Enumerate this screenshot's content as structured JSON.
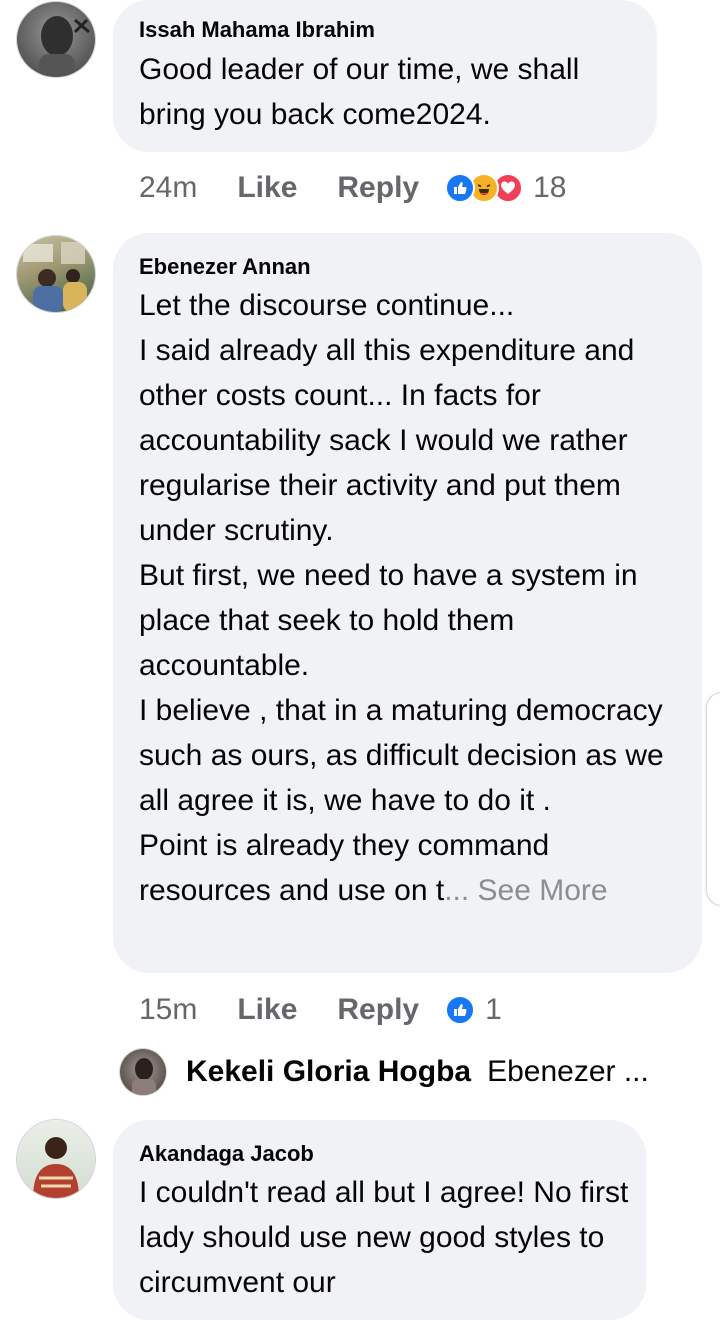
{
  "comments": [
    {
      "author": "Issah Mahama Ibrahim",
      "text": "Good leader of our time, we shall bring you back come2024.",
      "time": "24m",
      "like_label": "Like",
      "reply_label": "Reply",
      "reactions": [
        "like",
        "haha",
        "love"
      ],
      "reaction_count": "18"
    },
    {
      "author": "Ebenezer Annan",
      "text": "Let the discourse continue...\nI said already all this expenditure and other costs count...  In facts for accountability sack I would we rather regularise their activity and put them under scrutiny.\nBut first, we need to have a system in place that seek to hold them accountable.\nI believe , that in a maturing democracy such as ours, as difficult decision as we all agree it is, we have to do it .\nPoint is already they command resources and use on t",
      "see_more": "... See More",
      "time": "15m",
      "like_label": "Like",
      "reply_label": "Reply",
      "reactions": [
        "like"
      ],
      "reaction_count": "1",
      "reply_preview": {
        "author": "Kekeli Gloria Hogba",
        "text": "Ebenezer ..."
      }
    },
    {
      "author": "Akandaga Jacob",
      "text": "I couldn't read all but I agree! No first lady should use new good styles to circumvent our"
    }
  ],
  "colors": {
    "bubble": "#f0f2f5",
    "meta_text": "#65676b",
    "like_blue": "#1877f2",
    "haha_yellow": "#f7b125",
    "love_red": "#f33e58"
  }
}
